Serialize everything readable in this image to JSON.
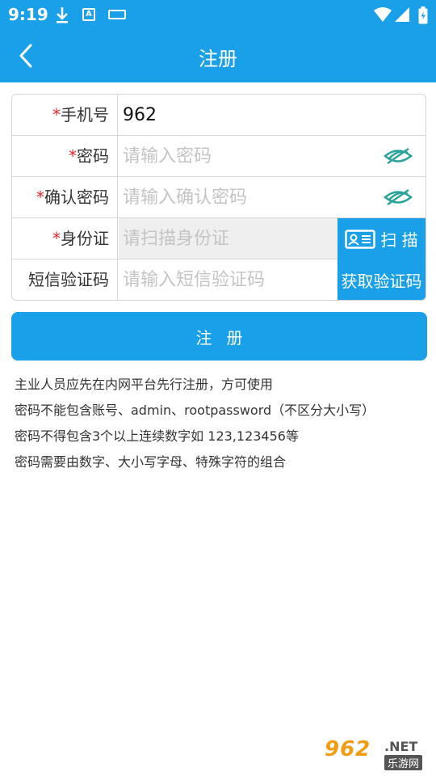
{
  "status_bar": {
    "time": "9:19",
    "icons": [
      "download-icon",
      "a-icon",
      "keyboard-icon",
      "wifi-icon",
      "signal-icon",
      "battery-icon"
    ],
    "a_icon_text": "A"
  },
  "header": {
    "title": "注册",
    "back_icon": "chevron-left-icon"
  },
  "form": {
    "required_mark": "*",
    "phone": {
      "label": "手机号",
      "value": "962"
    },
    "password": {
      "label": "密码",
      "placeholder": "请输入密码",
      "icon": "eye-hidden-icon"
    },
    "confirm_password": {
      "label": "确认密码",
      "placeholder": "请输入确认密码",
      "icon": "eye-hidden-icon"
    },
    "id_card": {
      "label": "身份证",
      "placeholder": "请扫描身份证",
      "scan_label": "扫 描",
      "scan_icon": "id-card-icon"
    },
    "sms_code": {
      "label": "短信验证码",
      "placeholder": "请输入短信验证码",
      "get_code_label": "获取验证码"
    }
  },
  "register_button": {
    "label": "注册"
  },
  "notes": [
    "主业人员应先在内网平台先行注册，方可使用",
    "密码不能包含账号、admin、rootpassword（不区分大小写）",
    "密码不得包含3个以上连续数字如 123,123456等",
    "密码需要由数字、大小写字母、特殊字符的组合"
  ],
  "watermark": {
    "main": "962",
    "net": ".NET",
    "sub": "乐游网"
  },
  "colors": {
    "primary": "#1aa0e8",
    "required": "#e8262b",
    "eye_icon": "#2aa39b",
    "border": "#d6d6d6",
    "disabled_bg": "#efefef"
  }
}
